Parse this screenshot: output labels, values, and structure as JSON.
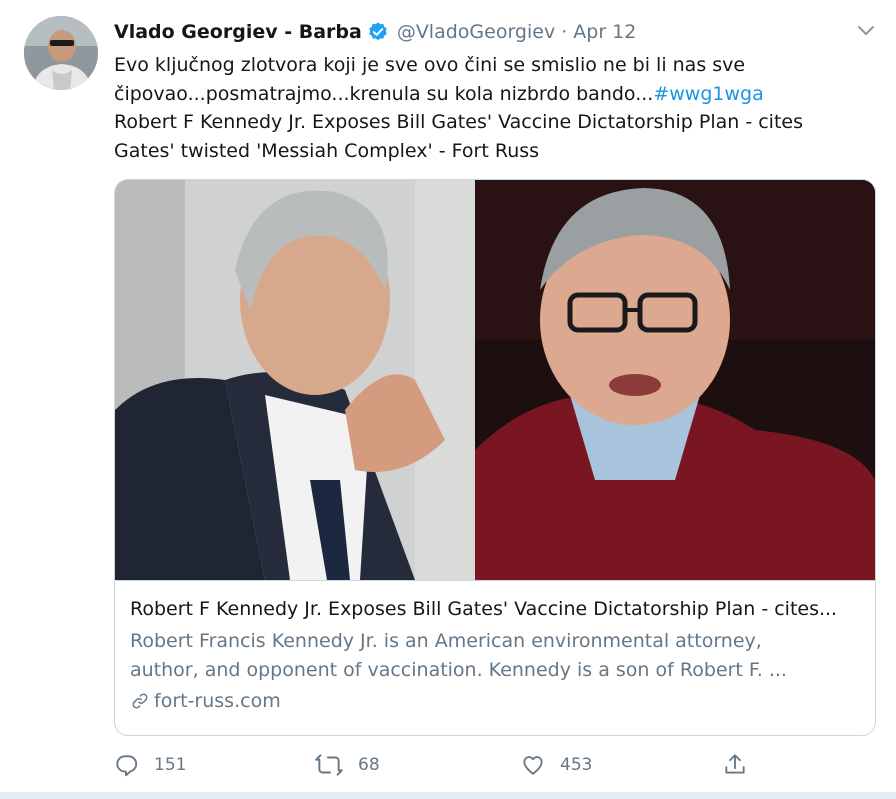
{
  "tweet": {
    "author_name": "Vlado Georgiev - Barba",
    "handle": "@VladoGeorgiev",
    "separator": "·",
    "date": "Apr 12",
    "text_line1": "Evo ključnog zlotvora koji je sve ovo čini se smislio ne bi li nas sve",
    "text_line2": "čipovao...posmatrajmo...krenula su kola nizbrdo bando...",
    "hashtag": "#wwg1wga",
    "text_line3": "Robert F Kennedy Jr. Exposes Bill Gates' Vaccine Dictatorship Plan - cites",
    "text_line4": "Gates' twisted 'Messiah Complex' - Fort Russ"
  },
  "card": {
    "title": "Robert F Kennedy Jr. Exposes Bill Gates' Vaccine Dictatorship Plan - cites...",
    "description_line1": "Robert Francis Kennedy Jr. is an American environmental attorney,",
    "description_line2": "author, and opponent of vaccination. Kennedy is a son of Robert F. ...",
    "domain": "fort-russ.com"
  },
  "actions": {
    "reply_count": "151",
    "retweet_count": "68",
    "like_count": "453"
  },
  "icons": {
    "verified": "verified-badge-icon",
    "caret": "chevron-down-icon",
    "link": "link-icon",
    "reply": "reply-icon",
    "retweet": "retweet-icon",
    "like": "heart-icon",
    "share": "share-icon"
  },
  "colors": {
    "accent": "#1da1f2",
    "hashtag": "#1b95e0",
    "secondary_text": "#657786",
    "border": "#ccd6dd"
  }
}
